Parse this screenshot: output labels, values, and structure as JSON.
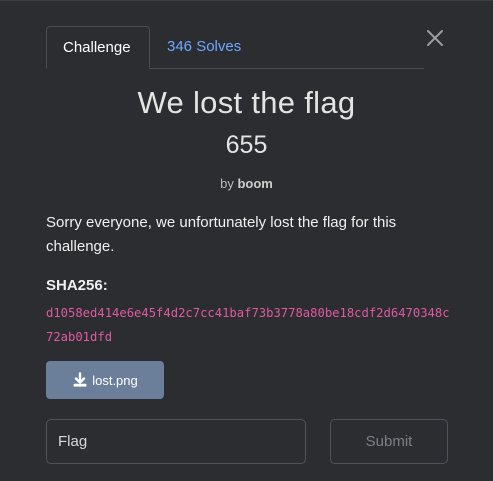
{
  "tabs": {
    "challenge_label": "Challenge",
    "solves_label": "346 Solves"
  },
  "challenge": {
    "name": "We lost the flag",
    "points": "655",
    "author_prefix": "by",
    "author": "boom",
    "description": "Sorry everyone, we unfortunately lost the flag for this challenge.",
    "hash_label": "SHA256:",
    "hash_value": "d1058ed414e6e45f4d2c7cc41baf73b3778a80be18cdf2d6470348c72ab01dfd"
  },
  "file": {
    "label": "lost.png",
    "icon": "download-icon"
  },
  "flag_form": {
    "placeholder": "Flag",
    "submit_label": "Submit"
  },
  "colors": {
    "modal_bg": "#2b2d31",
    "link_blue": "#6ea7ff",
    "hash_pink": "#e05aa0",
    "file_button": "#6b7f9b"
  }
}
